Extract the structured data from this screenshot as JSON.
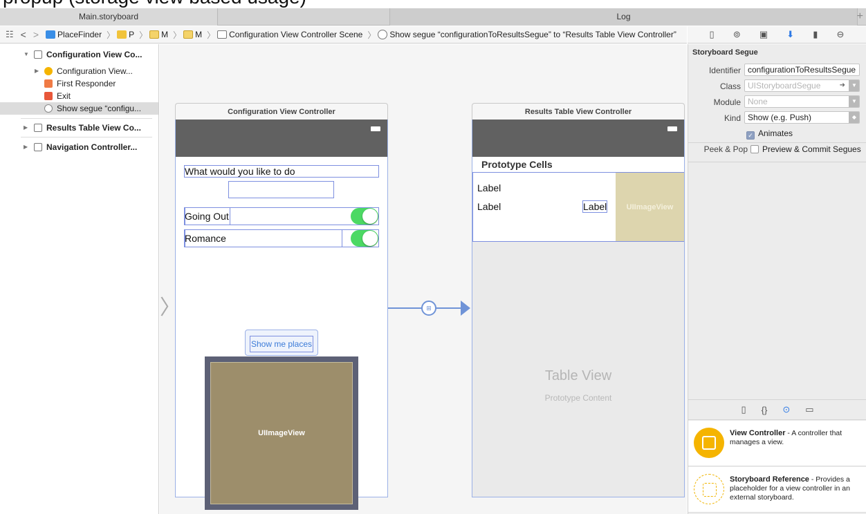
{
  "top_strip": "propup (storage view based usage)",
  "tabs": [
    {
      "label": "Main.storyboard"
    },
    {
      "label": "Log"
    }
  ],
  "tab_add": "+",
  "jumpbar": {
    "nav_back": "<",
    "nav_forward": ">",
    "crumbs": [
      "PlaceFinder",
      "P",
      "M",
      "M",
      "Configuration View Controller Scene",
      "Show segue “configurationToResultsSegue” to “Results Table View Controller”"
    ]
  },
  "outline": {
    "items": [
      {
        "label": "Configuration View Co..."
      },
      {
        "label": "Configuration View..."
      },
      {
        "label": "First Responder"
      },
      {
        "label": "Exit"
      },
      {
        "label": "Show segue “configu..."
      },
      {
        "label": "Results Table View Co..."
      },
      {
        "label": "Navigation Controller..."
      }
    ]
  },
  "canvas": {
    "config_vc": {
      "title": "Configuration View Controller",
      "question_label": "What would you like to do",
      "text_field_value": "",
      "option1_label": "Going Out",
      "option2_label": "Romance",
      "button_label": "Show me places",
      "image_view_label": "UIImageView"
    },
    "results_vc": {
      "title": "Results Table View Controller",
      "section_header": "Prototype Cells",
      "cell_label1": "Label",
      "cell_label2": "Label",
      "cell_label3": "Label",
      "cell_image_label": "UIImageView",
      "table_title": "Table View",
      "table_subtitle": "Prototype Content"
    }
  },
  "inspector": {
    "section_title": "Storyboard Segue",
    "identifier_label": "Identifier",
    "identifier_value": "configurationToResultsSegue",
    "class_label": "Class",
    "class_placeholder": "UIStoryboardSegue",
    "module_label": "Module",
    "module_placeholder": "None",
    "kind_label": "Kind",
    "kind_value": "Show (e.g. Push)",
    "animates_label": "Animates",
    "animates_checked": true,
    "peek_label": "Peek & Pop",
    "peek_value": "Preview & Commit Segues",
    "peek_checked": false
  },
  "library": {
    "items": [
      {
        "title": "View Controller",
        "desc": " - A controller that manages a view."
      },
      {
        "title": "Storyboard Reference",
        "desc": " - Provides a placeholder for a view controller in an external storyboard."
      }
    ]
  },
  "colors": {
    "toggle_on": "#4cd964",
    "image_view_config": "#9d8e6b",
    "image_view_cell": "#ddd5ae",
    "selection_blue": "#7d8fe0",
    "inspector_accent": "#2f7ae5",
    "nav_bar": "#616161"
  },
  "icons": [
    "grid-icon",
    "document-icon",
    "help-icon",
    "identity-icon",
    "attributes-icon",
    "size-icon",
    "connections-icon",
    "braces-icon",
    "object-icon",
    "media-icon"
  ]
}
